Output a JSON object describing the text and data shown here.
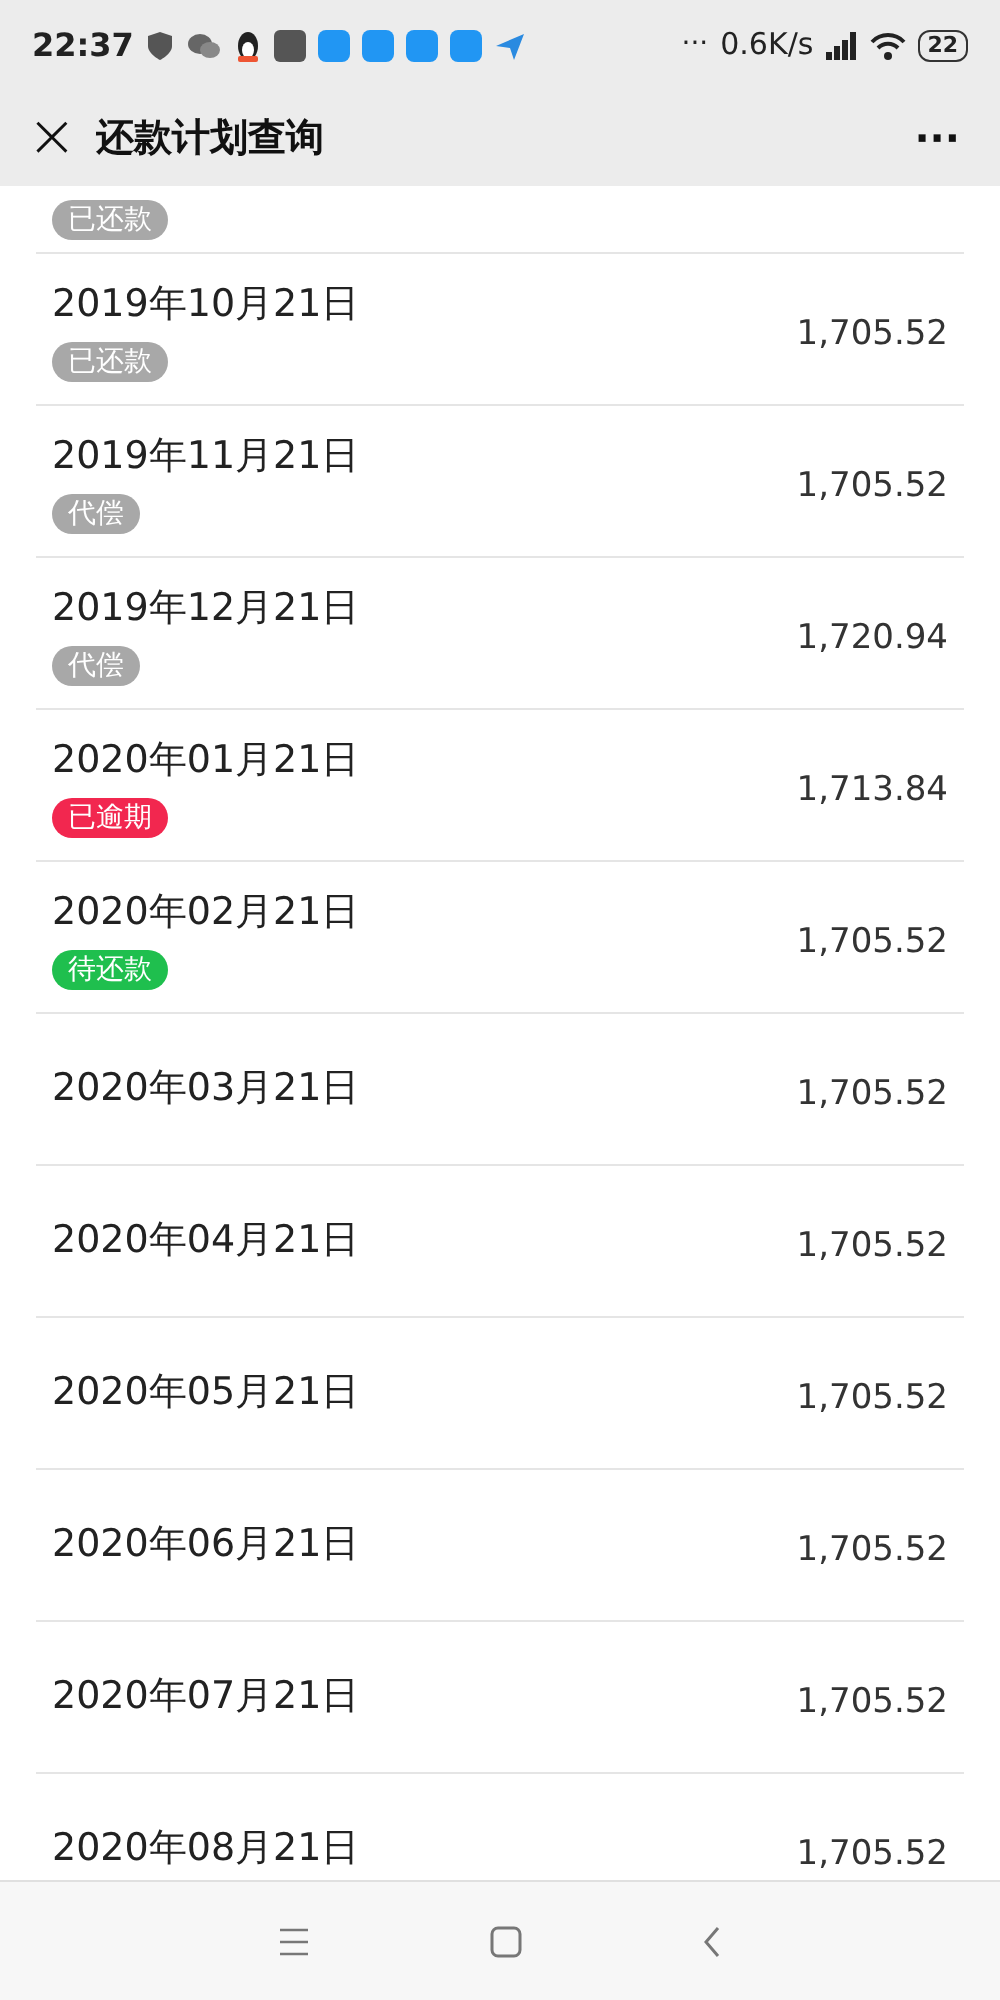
{
  "status_bar": {
    "time": "22:37",
    "more": "···",
    "speed": "0.6K/s",
    "battery": "22"
  },
  "header": {
    "close": "×",
    "title": "还款计划查询",
    "more": "···"
  },
  "partial_row": {
    "status": {
      "label": "已还款",
      "kind": "paid"
    }
  },
  "rows": [
    {
      "date": "2019年10月21日",
      "amount": "1,705.52",
      "status": {
        "label": "已还款",
        "kind": "paid"
      }
    },
    {
      "date": "2019年11月21日",
      "amount": "1,705.52",
      "status": {
        "label": "代偿",
        "kind": "compensated"
      }
    },
    {
      "date": "2019年12月21日",
      "amount": "1,720.94",
      "status": {
        "label": "代偿",
        "kind": "compensated"
      }
    },
    {
      "date": "2020年01月21日",
      "amount": "1,713.84",
      "status": {
        "label": "已逾期",
        "kind": "overdue"
      }
    },
    {
      "date": "2020年02月21日",
      "amount": "1,705.52",
      "status": {
        "label": "待还款",
        "kind": "pending"
      }
    },
    {
      "date": "2020年03月21日",
      "amount": "1,705.52"
    },
    {
      "date": "2020年04月21日",
      "amount": "1,705.52"
    },
    {
      "date": "2020年05月21日",
      "amount": "1,705.52"
    },
    {
      "date": "2020年06月21日",
      "amount": "1,705.52"
    },
    {
      "date": "2020年07月21日",
      "amount": "1,705.52"
    },
    {
      "date": "2020年08月21日",
      "amount": "1,705.52"
    }
  ]
}
